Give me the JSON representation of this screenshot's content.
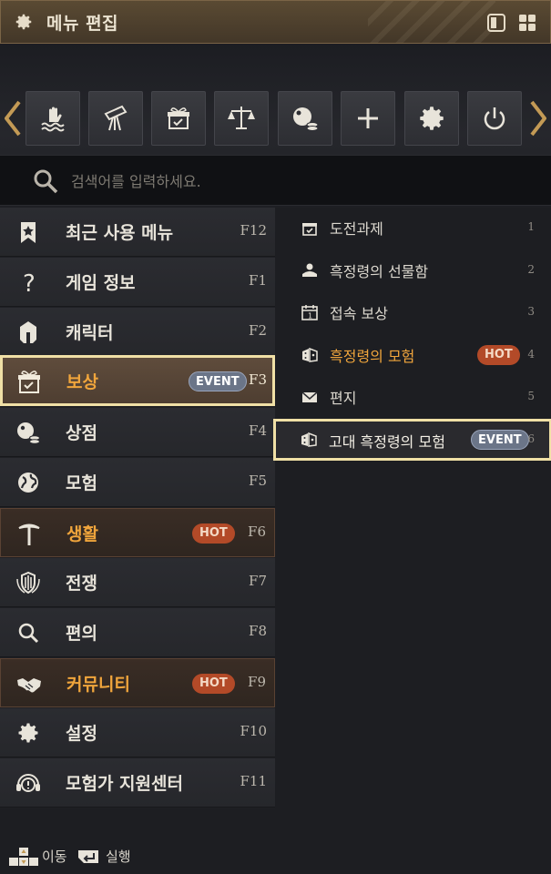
{
  "window": {
    "title": "메뉴 편집",
    "accent_color": "#f0a53c",
    "selected_border_color": "#f0e0a6"
  },
  "quick_bar": {
    "slots": [
      {
        "icon": "hand-over-water-icon"
      },
      {
        "icon": "scroll-telescope-icon"
      },
      {
        "icon": "gift-box-icon"
      },
      {
        "icon": "scales-icon"
      },
      {
        "icon": "shop-coins-icon"
      },
      {
        "icon": "plus-icon"
      },
      {
        "icon": "gear-icon"
      },
      {
        "icon": "power-icon"
      }
    ]
  },
  "search": {
    "placeholder": "검색어를 입력하세요.",
    "value": ""
  },
  "left_menu": {
    "items": [
      {
        "label": "최근 사용 메뉴",
        "key": "F12",
        "icon": "bookmark-star-icon"
      },
      {
        "label": "게임 정보",
        "key": "F1",
        "icon": "question-icon"
      },
      {
        "label": "캐릭터",
        "key": "F2",
        "icon": "helmet-icon"
      },
      {
        "label": "보상",
        "key": "F3",
        "icon": "gift-box-icon",
        "badge": "EVENT",
        "selected": true
      },
      {
        "label": "상점",
        "key": "F4",
        "icon": "shop-coins-icon"
      },
      {
        "label": "모험",
        "key": "F5",
        "icon": "globe-icon"
      },
      {
        "label": "생활",
        "key": "F6",
        "icon": "pickaxe-icon",
        "badge": "HOT"
      },
      {
        "label": "전쟁",
        "key": "F7",
        "icon": "shield-swords-icon"
      },
      {
        "label": "편의",
        "key": "F8",
        "icon": "magnifier-icon"
      },
      {
        "label": "커뮤니티",
        "key": "F9",
        "icon": "handshake-icon",
        "badge": "HOT"
      },
      {
        "label": "설정",
        "key": "F10",
        "icon": "gear-icon"
      },
      {
        "label": "모험가 지원센터",
        "key": "F11",
        "icon": "headset-icon"
      }
    ]
  },
  "sub_menu": {
    "items": [
      {
        "label": "도전과제",
        "num": "1",
        "icon": "gift-check-icon"
      },
      {
        "label": "흑정령의 선물함",
        "num": "2",
        "icon": "spirit-gift-icon"
      },
      {
        "label": "접속 보상",
        "num": "3",
        "icon": "calendar-icon"
      },
      {
        "label": "흑정령의 모험",
        "num": "4",
        "icon": "dice-icon",
        "badge": "HOT"
      },
      {
        "label": "편지",
        "num": "5",
        "icon": "envelope-icon"
      },
      {
        "label": "고대 흑정령의 모험",
        "num": "6",
        "icon": "dice-icon",
        "badge": "EVENT",
        "selected": true
      }
    ]
  },
  "footer": {
    "move_label": "이동",
    "exec_label": "실행"
  }
}
